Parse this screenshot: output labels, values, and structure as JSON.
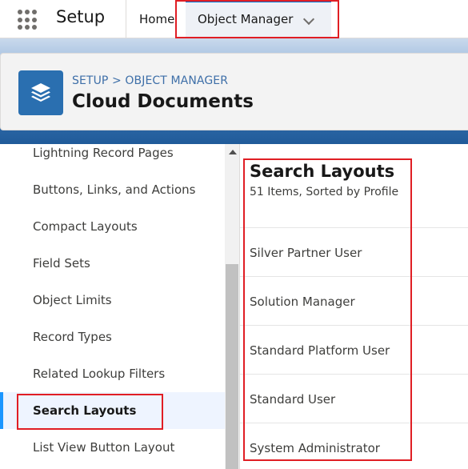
{
  "topnav": {
    "app_name": "Setup",
    "home_label": "Home",
    "active_tab_label": "Object Manager"
  },
  "header": {
    "breadcrumb": "SETUP > OBJECT MANAGER",
    "title": "Cloud Documents",
    "icon": "layers-icon"
  },
  "sidebar": {
    "items": [
      {
        "label": "Lightning Record Pages",
        "active": false
      },
      {
        "label": "Buttons, Links, and Actions",
        "active": false
      },
      {
        "label": "Compact Layouts",
        "active": false
      },
      {
        "label": "Field Sets",
        "active": false
      },
      {
        "label": "Object Limits",
        "active": false
      },
      {
        "label": "Record Types",
        "active": false
      },
      {
        "label": "Related Lookup Filters",
        "active": false
      },
      {
        "label": "Search Layouts",
        "active": true
      },
      {
        "label": "List View Button Layout",
        "active": false
      }
    ]
  },
  "main": {
    "title": "Search Layouts",
    "subtitle": "51 Items, Sorted by Profile",
    "rows": [
      "Silver Partner User",
      "Solution Manager",
      "Standard Platform User",
      "Standard User",
      "System Administrator"
    ]
  },
  "colors": {
    "brand_blue": "#0176d3",
    "highlight_red": "#e01e24",
    "active_bar": "#1b96ff"
  }
}
